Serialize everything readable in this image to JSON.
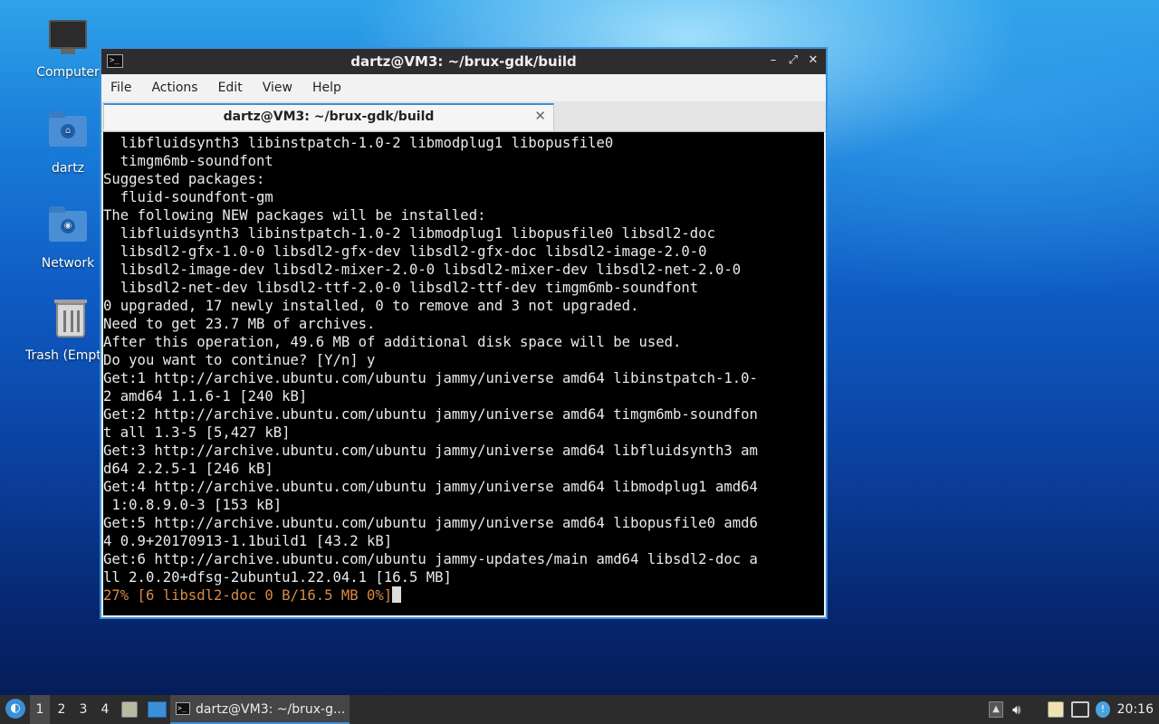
{
  "desktop": {
    "icons": [
      {
        "label": "Computer",
        "icon": "computer-icon"
      },
      {
        "label": "dartz",
        "icon": "home-folder-icon"
      },
      {
        "label": "Network",
        "icon": "network-folder-icon"
      },
      {
        "label": "Trash (Empt",
        "icon": "trash-icon"
      }
    ]
  },
  "window": {
    "title": "dartz@VM3: ~/brux-gdk/build",
    "controls": {
      "minimize": "–",
      "maximize": "⤢",
      "close": "✕"
    },
    "menu": [
      "File",
      "Actions",
      "Edit",
      "View",
      "Help"
    ],
    "tab": {
      "title": "dartz@VM3: ~/brux-gdk/build",
      "close": "✕"
    }
  },
  "terminal": {
    "lines": [
      "  libfluidsynth3 libinstpatch-1.0-2 libmodplug1 libopusfile0",
      "  timgm6mb-soundfont",
      "Suggested packages:",
      "  fluid-soundfont-gm",
      "The following NEW packages will be installed:",
      "  libfluidsynth3 libinstpatch-1.0-2 libmodplug1 libopusfile0 libsdl2-doc",
      "  libsdl2-gfx-1.0-0 libsdl2-gfx-dev libsdl2-gfx-doc libsdl2-image-2.0-0",
      "  libsdl2-image-dev libsdl2-mixer-2.0-0 libsdl2-mixer-dev libsdl2-net-2.0-0",
      "  libsdl2-net-dev libsdl2-ttf-2.0-0 libsdl2-ttf-dev timgm6mb-soundfont",
      "0 upgraded, 17 newly installed, 0 to remove and 3 not upgraded.",
      "Need to get 23.7 MB of archives.",
      "After this operation, 49.6 MB of additional disk space will be used.",
      "Do you want to continue? [Y/n] y",
      "Get:1 http://archive.ubuntu.com/ubuntu jammy/universe amd64 libinstpatch-1.0-",
      "2 amd64 1.1.6-1 [240 kB]",
      "Get:2 http://archive.ubuntu.com/ubuntu jammy/universe amd64 timgm6mb-soundfon",
      "t all 1.3-5 [5,427 kB]",
      "Get:3 http://archive.ubuntu.com/ubuntu jammy/universe amd64 libfluidsynth3 am",
      "d64 2.2.5-1 [246 kB]",
      "Get:4 http://archive.ubuntu.com/ubuntu jammy/universe amd64 libmodplug1 amd64",
      " 1:0.8.9.0-3 [153 kB]",
      "Get:5 http://archive.ubuntu.com/ubuntu jammy/universe amd64 libopusfile0 amd6",
      "4 0.9+20170913-1.1build1 [43.2 kB]",
      "Get:6 http://archive.ubuntu.com/ubuntu jammy-updates/main amd64 libsdl2-doc a",
      "ll 2.0.20+dfsg-2ubuntu1.22.04.1 [16.5 MB]"
    ],
    "progress_line": "27% [6 libsdl2-doc 0 B/16.5 MB 0%]",
    "progress_color": "#d98a45"
  },
  "taskbar": {
    "start_icon": "start-menu-icon",
    "workspaces": [
      "1",
      "2",
      "3",
      "4"
    ],
    "active_workspace": "1",
    "launchers": [
      "file-manager-icon",
      "browser-icon"
    ],
    "task_label": "dartz@VM3: ~/brux-g...",
    "tray": [
      "tray-up-icon",
      "volume-icon",
      "clipboard-icon",
      "network-icon",
      "update-notifier-icon"
    ],
    "clock": "20:16"
  }
}
